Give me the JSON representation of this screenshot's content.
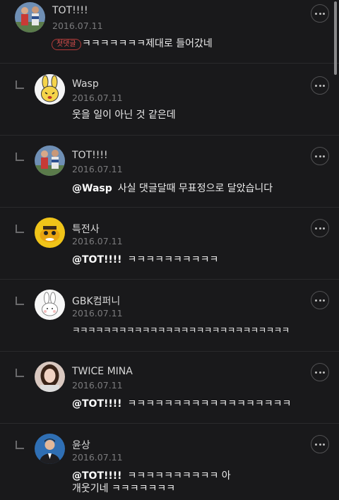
{
  "badge_label": "첫댓글",
  "comments": [
    {
      "username": "TOT!!!!",
      "date": "2016.07.11",
      "mention": "",
      "text": "ㅋㅋㅋㅋㅋㅋㅋ제대로 들어갔네",
      "avatar": "soccer-players-avatar"
    },
    {
      "username": "Wasp",
      "date": "2016.07.11",
      "mention": "",
      "text": "웃을 일이 아닌 것 같은데",
      "avatar": "yellow-rabbit-character-avatar"
    },
    {
      "username": "TOT!!!!",
      "date": "2016.07.11",
      "mention": "@Wasp",
      "text": "사실 댓글달때 무표정으로 달았습니다",
      "avatar": "soccer-players-avatar"
    },
    {
      "username": "특전사",
      "date": "2016.07.11",
      "mention": "@TOT!!!!",
      "text": "ㅋㅋㅋㅋㅋㅋㅋㅋㅋㅋ",
      "avatar": "yellow-cartoon-avatar"
    },
    {
      "username": "GBK컴퍼니",
      "date": "2016.07.11",
      "mention": "",
      "text": "ㅋㅋㅋㅋㅋㅋㅋㅋㅋㅋㅋㅋㅋㅋㅋㅋㅋㅋㅋㅋㅋㅋㅋㅋㅋㅋㅋㅋ",
      "avatar": "white-rabbit-avatar"
    },
    {
      "username": "TWICE MINA",
      "date": "2016.07.11",
      "mention": "@TOT!!!!",
      "text": "ㅋㅋㅋㅋㅋㅋㅋㅋㅋㅋㅋㅋㅋㅋㅋㅋㅋㅋ",
      "avatar": "woman-portrait-avatar"
    },
    {
      "username": "윤상",
      "date": "2016.07.11",
      "mention": "@TOT!!!!",
      "text": "ㅋㅋㅋㅋㅋㅋㅋㅋㅋㅋ 아",
      "text_line2": "개웃기네 ㅋㅋㅋㅋㅋㅋㅋ",
      "avatar": "man-in-suit-avatar"
    }
  ]
}
